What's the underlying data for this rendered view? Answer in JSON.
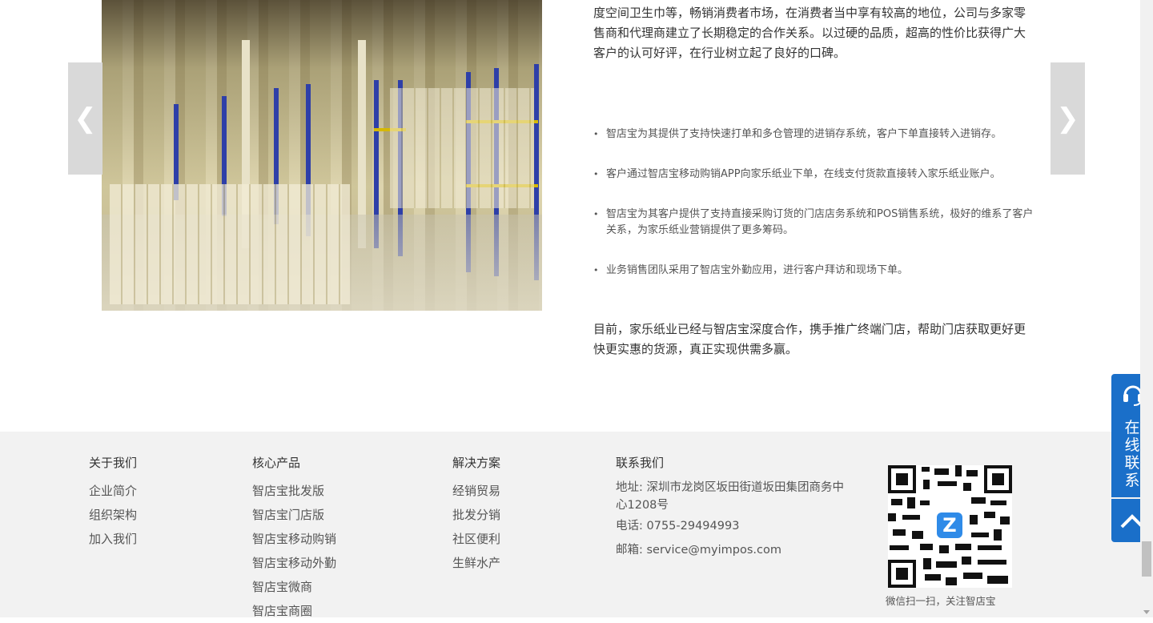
{
  "content": {
    "intro": "度空间卫生巾等，畅销消费者市场，在消费者当中享有较高的地位，公司与多家零售商和代理商建立了长期稳定的合作关系。以过硬的品质，超高的性价比获得广大客户的认可好评，在行业树立起了良好的口碑。",
    "bullets": [
      "智店宝为其提供了支持快速打单和多仓管理的进销存系统，客户下单直接转入进销存。",
      "客户通过智店宝移动购销APP向家乐纸业下单，在线支付货款直接转入家乐纸业账户。",
      "智店宝为其客户提供了支持直接采购订货的门店店务系统和POS销售系统，极好的维系了客户关系，为家乐纸业营销提供了更多筹码。",
      "业务销售团队采用了智店宝外勤应用，进行客户拜访和现场下单。"
    ],
    "closing": "目前，家乐纸业已经与智店宝深度合作，携手推广终端门店，帮助门店获取更好更快更实惠的货源，真正实现供需多赢。"
  },
  "slider": {
    "prev_glyph": "❮",
    "next_glyph": "❯"
  },
  "footer": {
    "about": {
      "title": "关于我们",
      "links": [
        "企业简介",
        "组织架构",
        "加入我们"
      ]
    },
    "products": {
      "title": "核心产品",
      "links": [
        "智店宝批发版",
        "智店宝门店版",
        "智店宝移动购销",
        "智店宝移动外勤",
        "智店宝微商",
        "智店宝商圈"
      ]
    },
    "solutions": {
      "title": "解决方案",
      "links": [
        "经销贸易",
        "批发分销",
        "社区便利",
        "生鲜水产"
      ]
    },
    "contact": {
      "title": "联系我们",
      "address": "地址: 深圳市龙岗区坂田街道坂田集团商务中心1208号",
      "phone": "电话: 0755-29494993",
      "email": "邮箱: service@myimpos.com"
    },
    "qr": {
      "logo_letter": "Z",
      "caption": "微信扫一扫，关注智店宝"
    }
  },
  "side_widget": {
    "contact_label": "在线联系",
    "accent_color": "#1a6fc9"
  }
}
